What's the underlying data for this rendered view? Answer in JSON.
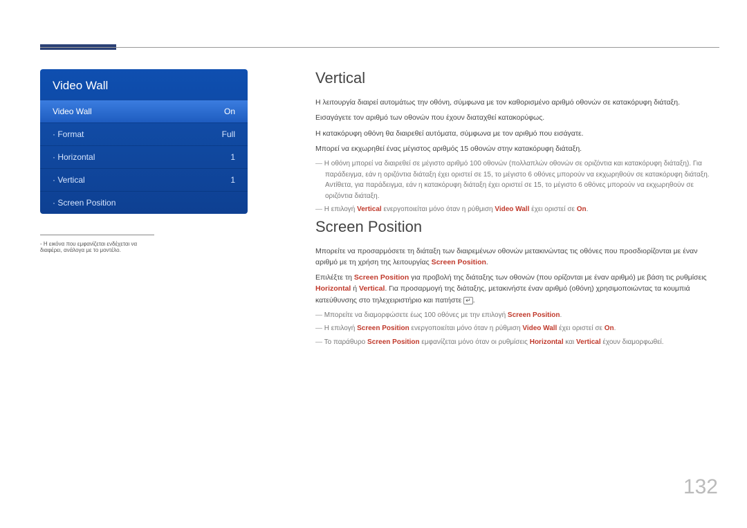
{
  "page_number": "132",
  "menu": {
    "title": "Video Wall",
    "items": [
      {
        "label": "Video Wall",
        "value": "On"
      },
      {
        "label": "· Format",
        "value": "Full"
      },
      {
        "label": "· Horizontal",
        "value": "1"
      },
      {
        "label": "· Vertical",
        "value": "1"
      },
      {
        "label": "· Screen Position",
        "value": ""
      }
    ],
    "caption_prefix": "-",
    "caption": "Η εικόνα που εμφανίζεται ενδέχεται να διαφέρει, ανάλογα με το μοντέλο."
  },
  "vertical": {
    "heading": "Vertical",
    "p1": "Η λειτουργία διαιρεί αυτομάτως την οθόνη, σύμφωνα με τον καθορισμένο αριθμό οθονών σε κατακόρυφη διάταξη.",
    "p2": "Εισαγάγετε τον αριθμό των οθονών που έχουν διαταχθεί κατακορύφως.",
    "p3": "Η κατακόρυφη οθόνη θα διαιρεθεί αυτόματα, σύμφωνα με τον αριθμό που εισάγατε.",
    "p4": "Μπορεί να εκχωρηθεί ένας μέγιστος αριθμός 15 οθονών στην κατακόρυφη διάταξη.",
    "note1": "Η οθόνη μπορεί να διαιρεθεί σε μέγιστο αριθμό 100 οθονών (πολλαπλών οθονών σε οριζόντια και κατακόρυφη διάταξη). Για παράδειγμα, εάν η οριζόντια διάταξη έχει οριστεί σε 15, το μέγιστο 6 οθόνες μπορούν να εκχωρηθούν σε κατακόρυφη διάταξη. Αντίθετα, για παράδειγμα, εάν η κατακόρυφη διάταξη έχει οριστεί σε 15, το μέγιστο 6 οθόνες μπορούν να εκχωρηθούν σε οριζόντια διάταξη.",
    "note2_pre": "Η επιλογή ",
    "note2_vert": "Vertical",
    "note2_mid": " ενεργοποιείται μόνο όταν η ρύθμιση ",
    "note2_vw": "Video Wall",
    "note2_mid2": " έχει οριστεί σε ",
    "note2_on": "On",
    "note2_end": "."
  },
  "screen_position": {
    "heading": "Screen Position",
    "p1_pre": "Μπορείτε να προσαρμόσετε τη διάταξη των διαιρεμένων οθονών μετακινώντας τις οθόνες που προσδιορίζονται με έναν αριθμό με τη χρήση της λειτουργίας ",
    "p1_sp": "Screen Position",
    "p1_end": ".",
    "p2_a": "Επιλέξτε τη ",
    "p2_sp": "Screen Position",
    "p2_b": " για προβολή της διάταξης των οθονών (που ορίζονται με έναν αριθμό) με βάση τις ρυθμίσεις ",
    "p2_h": "Horizontal",
    "p2_or": " ή ",
    "p2_v": "Vertical",
    "p2_c": ". Για προσαρμογή της διάταξης, μετακινήστε έναν αριθμό (οθόνη) χρησιμοποιώντας τα κουμπιά κατεύθυνσης στο τηλεχειριστήριο και πατήστε ",
    "p2_icon": "↵",
    "p2_end": ".",
    "note1_pre": "Μπορείτε να διαμορφώσετε έως 100 οθόνες με την επιλογή ",
    "note1_sp": "Screen Position",
    "note1_end": ".",
    "note2_pre": "Η επιλογή ",
    "note2_sp": "Screen Position",
    "note2_mid": " ενεργοποιείται μόνο όταν η ρύθμιση ",
    "note2_vw": "Video Wall",
    "note2_mid2": " έχει οριστεί σε ",
    "note2_on": "On",
    "note2_end": ".",
    "note3_pre": "Το παράθυρο ",
    "note3_sp": "Screen Position",
    "note3_mid": " εμφανίζεται μόνο όταν οι ρυθμίσεις ",
    "note3_h": "Horizontal",
    "note3_and": " και ",
    "note3_v": "Vertical",
    "note3_end": " έχουν διαμορφωθεί."
  }
}
